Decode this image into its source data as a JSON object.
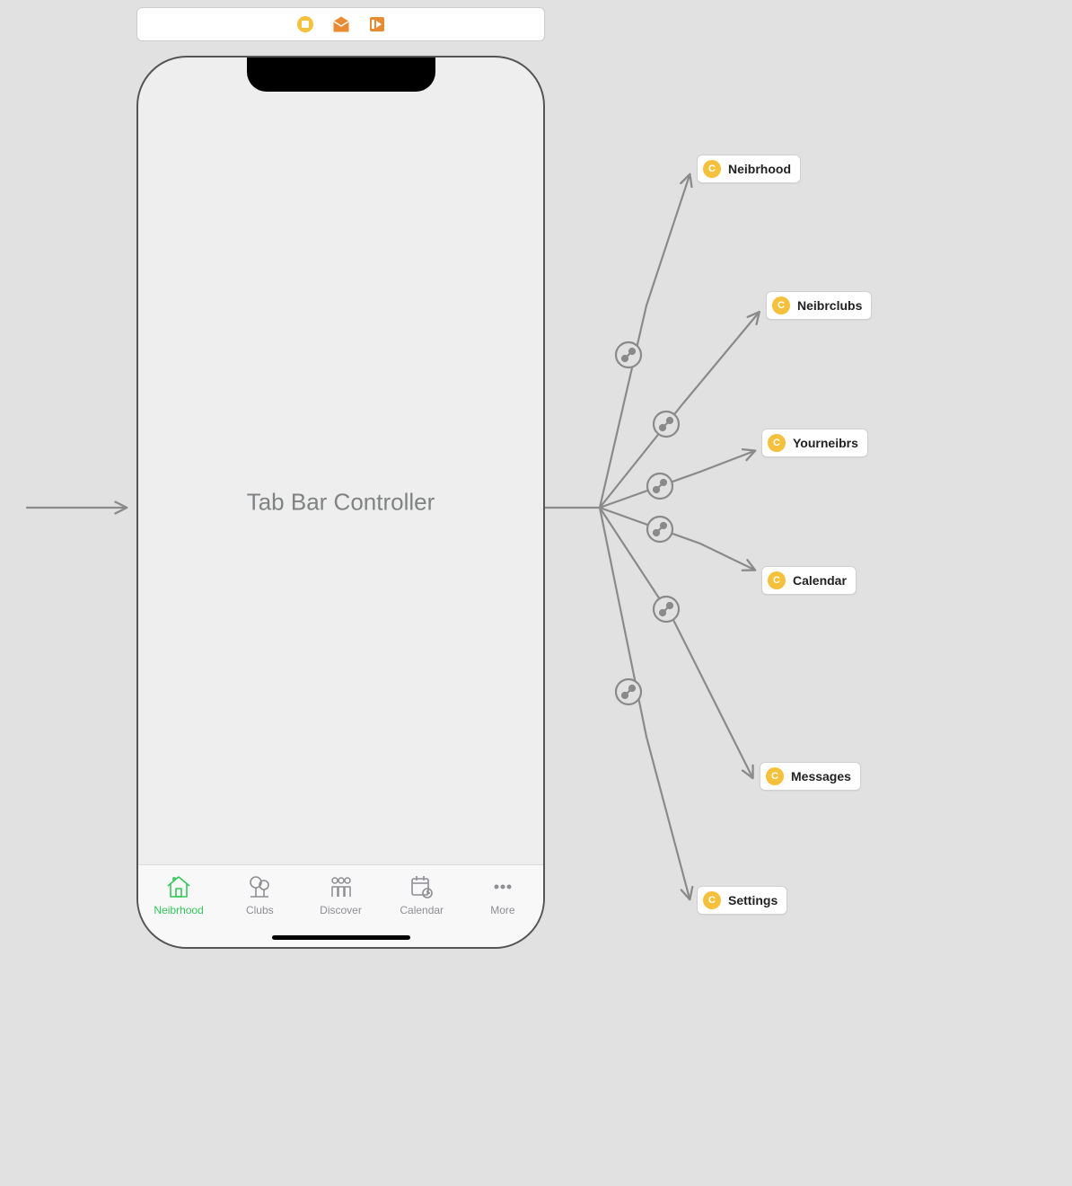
{
  "screen": {
    "title": "Tab Bar Controller"
  },
  "tabs": [
    {
      "label": "Neibrhood",
      "selected": true
    },
    {
      "label": "Clubs",
      "selected": false
    },
    {
      "label": "Discover",
      "selected": false
    },
    {
      "label": "Calendar",
      "selected": false
    },
    {
      "label": "More",
      "selected": false
    }
  ],
  "destinations": [
    {
      "label": "Neibrhood",
      "badge": "C"
    },
    {
      "label": "Neibrclubs",
      "badge": "C"
    },
    {
      "label": "Yourneibrs",
      "badge": "C"
    },
    {
      "label": "Calendar",
      "badge": "C"
    },
    {
      "label": "Messages",
      "badge": "C"
    },
    {
      "label": "Settings",
      "badge": "C"
    }
  ]
}
